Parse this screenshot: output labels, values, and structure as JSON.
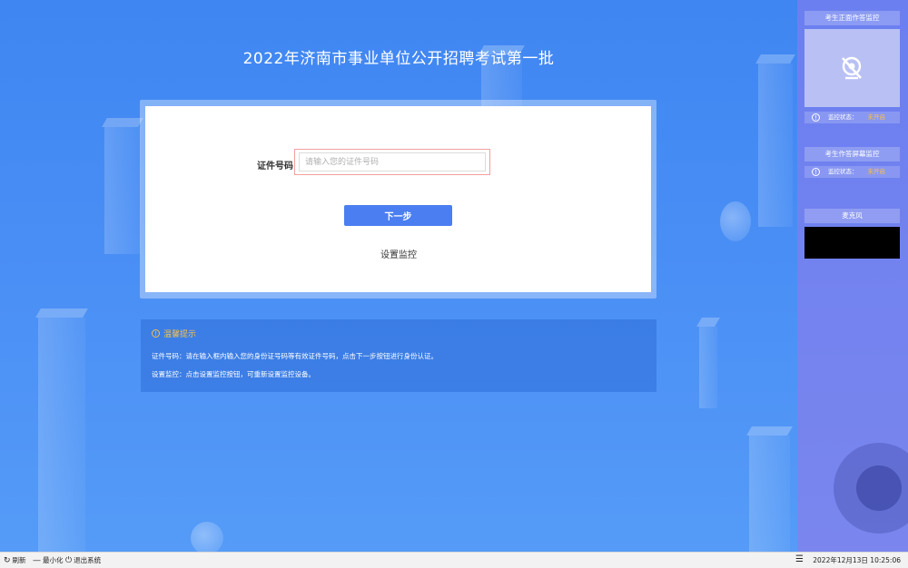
{
  "page": {
    "title": "2022年济南市事业单位公开招聘考试第一批"
  },
  "form": {
    "id_label": "证件号码",
    "id_placeholder": "请输入您的证件号码",
    "next_label": "下一步",
    "monitor_link": "设置监控"
  },
  "tips": {
    "title": "温馨提示",
    "lines": [
      "证件号码：请在输入框内输入您的身份证号码等有效证件号码，点击下一步按钮进行身份认证。",
      "设置监控：点击设置监控按钮，可重新设置监控设备。"
    ]
  },
  "sidebar": {
    "front_monitor_title": "考生正面作答监控",
    "front_status_label": "监控状态：",
    "front_status_value": "未开启",
    "screen_monitor_title": "考生作答屏幕监控",
    "screen_status_label": "监控状态：",
    "screen_status_value": "未开启",
    "mic_title": "麦克风"
  },
  "taskbar": {
    "refresh": "刷新",
    "minimize": "最小化",
    "exit": "退出系统",
    "clock": "2022年12月13日 10:25:06"
  },
  "colors": {
    "primary_button": "#4b7ef0",
    "status_off": "#f6c04d",
    "input_border_error": "#f2a0a0"
  },
  "icons": {
    "camera_off": "camera-off-icon",
    "info": "info-icon",
    "refresh": "refresh-icon",
    "minimize": "minimize-icon",
    "power": "power-icon",
    "tray": "list-icon"
  }
}
